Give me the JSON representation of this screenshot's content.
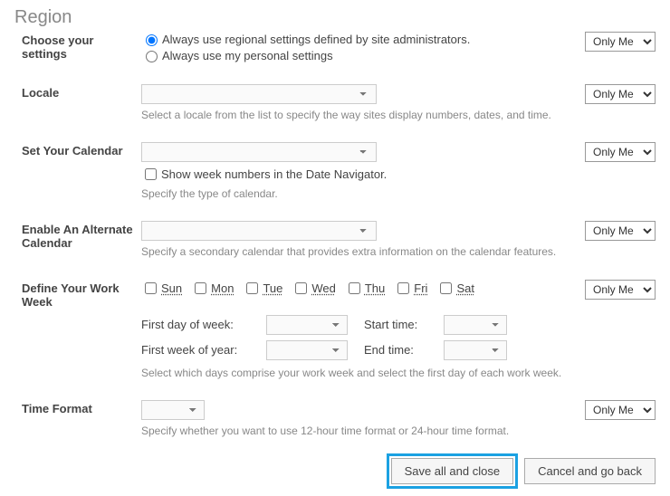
{
  "section_title": "Region",
  "privacy_option": "Only Me",
  "rows": {
    "choose": {
      "label": "Choose your settings",
      "radio1": "Always use regional settings defined by site administrators.",
      "radio2": "Always use my personal settings"
    },
    "locale": {
      "label": "Locale",
      "desc": "Select a locale from the list to specify the way sites display numbers, dates, and time."
    },
    "calendar": {
      "label": "Set Your Calendar",
      "check": "Show week numbers in the Date Navigator.",
      "desc": "Specify the type of calendar."
    },
    "altcal": {
      "label": "Enable An Alternate Calendar",
      "desc": "Specify a secondary calendar that provides extra information on the calendar features."
    },
    "workweek": {
      "label": "Define Your Work Week",
      "days": [
        "Sun",
        "Mon",
        "Tue",
        "Wed",
        "Thu",
        "Fri",
        "Sat"
      ],
      "first_day_label": "First day of week:",
      "first_week_label": "First week of year:",
      "start_time_label": "Start time:",
      "end_time_label": "End time:",
      "desc": "Select which days comprise your work week and select the first day of each work week."
    },
    "timeformat": {
      "label": "Time Format",
      "desc": "Specify whether you want to use 12-hour time format or 24-hour time format."
    }
  },
  "footer": {
    "save": "Save all and close",
    "cancel": "Cancel and go back"
  }
}
